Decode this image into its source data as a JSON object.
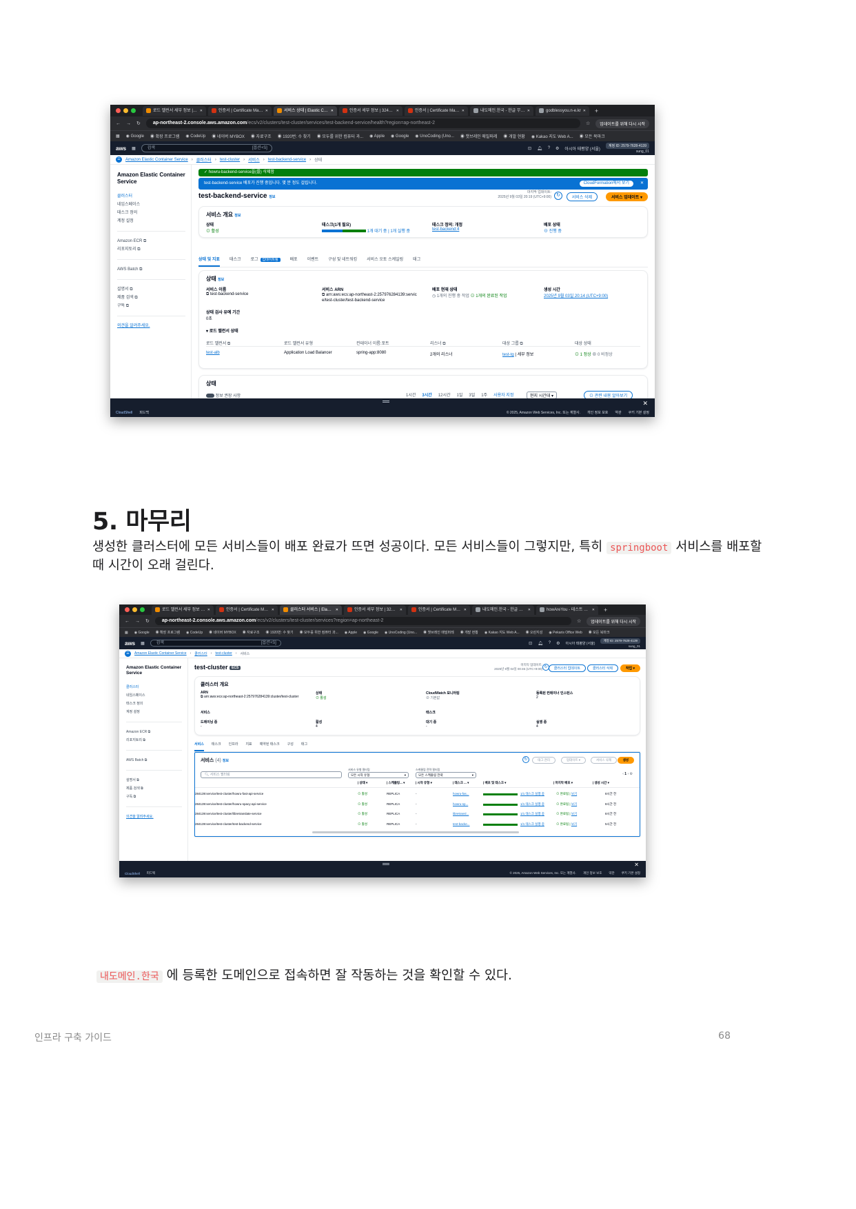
{
  "shot1": {
    "browser_tabs": [
      {
        "label": "로드 밸런서 세부 정보 | EC2",
        "color": "#f08c00"
      },
      {
        "label": "인증서 | Certificate Mana",
        "color": "#d13212"
      },
      {
        "label": "서비스 상태 | Elastic Conta",
        "color": "#f08c00"
      },
      {
        "label": "인증서 세부 정보 | 324448",
        "color": "#d13212"
      },
      {
        "label": "인증서 | Certificate Mana",
        "color": "#d13212"
      },
      {
        "label": "내도메인.한국 - 한글 무료 도",
        "color": "#9aa0a6"
      },
      {
        "label": "godblessyou.n-e.kr",
        "color": "#9aa0a6"
      }
    ],
    "url_host": "ap-northeast-2.console.aws.amazon.com",
    "url_path": "/ecs/v2/clusters/test-cluster/services/test-backend-service/health?region=ap-northeast-2",
    "update_button": "업데이트를 위해 다시 시작",
    "bookmarks": [
      "Google",
      "확장 프로그램",
      "CodeUp",
      "네이버 MYBOX",
      "자료구조",
      "1920번: 수 찾기",
      "모두를 위한 컴퓨터 과...",
      "Apple",
      "Google",
      "UnoCoding (Uno...",
      "챗브레인 매빌퍼레",
      "개발 현황",
      "Kakao 지도 Web A...",
      "모든 북마크"
    ],
    "aws_search_placeholder": "검색",
    "aws_search_kbd": "[옵션+S]",
    "account_id": "계정 ID: 2579-7628-4139",
    "account_user": "sung_01",
    "region": "아시아 태평양 (서울)",
    "breadcrumb": [
      "Amazon Elastic Container Service",
      "클러스터",
      "test-cluster",
      "서비스",
      "test-backend-service",
      "상태"
    ],
    "sidebar_title": "Amazon Elastic Container Service",
    "sidebar_items": [
      "클러스터",
      "네임스페이스",
      "태스크 정의",
      "계정 설정"
    ],
    "sidebar_items2": [
      "Amazon ECR",
      "리포지토리"
    ],
    "sidebar_items3": [
      "AWS Batch"
    ],
    "sidebar_items4": [
      "설명서",
      "제품 검색",
      "구독"
    ],
    "sidebar_feedback": "의견을 알려주세요.",
    "flash_success": "howru-backend-service을(를) 삭제함",
    "flash_info": "test-backend-service 배포가 진행 중입니다. 몇 분 정도 걸립니다.",
    "flash_info_button": "CloudFormation에서 보기",
    "page_title": "test-backend-service",
    "info_label": "정보",
    "last_updated_label": "마지막 업데이트:",
    "last_updated": "2025년 9월 03일 20:19 (UTC+9:00)",
    "delete_service": "서비스 삭제",
    "update_service": "서비스 업데이트",
    "overview_title": "서비스 개요",
    "overview": {
      "status_label": "상태",
      "status_value": "활성",
      "tasks_label": "태스크(1개 필요)",
      "tasks_value": "1개 대기 중 | 1개 실행 중",
      "taskdef_label": "태스크 정의: 개정",
      "taskdef_value": "test-backend:4",
      "deploy_label": "배포 상태",
      "deploy_value": "진행 중"
    },
    "tabs": [
      "상태 및 지표",
      "태스크",
      "로그",
      "배포",
      "이벤트",
      "구성 및 네트워킹",
      "서비스 오토 스케일링",
      "태그"
    ],
    "tab_badge": "업데이트됨",
    "status_title": "상태",
    "status": {
      "name_label": "서비스 이름",
      "name_value": "test-backend-service",
      "arn_label": "서비스 ARN",
      "arn_value": "arn:aws:ecs:ap-northeast-2:257976284139:service/test-cluster/test-backend-service",
      "deploy_label": "배포 현재 상태",
      "deploy_pending": "1개의 진행 중 작업",
      "deploy_done": "1개의 완료된 작업",
      "created_label": "생성 시간",
      "created_value": "2025년 9월 03일 20:14 (UTC+9:00)",
      "grace_label": "상태 검사 유예 기간",
      "grace_value": "0초"
    },
    "lb_title": "로드 밸런서 상태",
    "lb_headers": [
      "로드 밸런서",
      "로드 밸런서 유형",
      "컨테이너 이름:포트",
      "리스너",
      "대상 그룹",
      "대상 상태"
    ],
    "lb_row": [
      "test-alb",
      "Application Load Balancer",
      "spring-app:8080",
      "2개의 리스너",
      "test-tg",
      "세부 정보",
      "1 정상",
      "0 비정상"
    ],
    "health_title": "상태",
    "health_toggle": "정보 권장 사항",
    "time_ranges": [
      "1시간",
      "3시간",
      "12시간",
      "1일",
      "3일",
      "1주",
      "사용자 지정"
    ],
    "timezone": "현지 시간대",
    "related_button": "관련 내용 알아보기",
    "footer_left": [
      "CloudShell",
      "피드백"
    ],
    "footer_right": [
      "© 2025, Amazon Web Services, Inc. 또는 계열사.",
      "개인 정보 보호",
      "약관",
      "쿠키 기본 설정"
    ]
  },
  "heading": "5. 마무리",
  "paragraph_before": "생성한 클러스터에 모든 서비스들이 배포 완료가 뜨면 성공이다. 모든 서비스들이 그렇지만, 특히 ",
  "paragraph_code": "springboot",
  "paragraph_after": " 서비스를 배포할때 시간이 오래 걸린다.",
  "shot2": {
    "browser_tabs": [
      {
        "label": "로드 밸런서 세부 정보 | EC2 | ap",
        "color": "#f08c00"
      },
      {
        "label": "인증서 | Certificate Manager",
        "color": "#d13212"
      },
      {
        "label": "클러스터 서비스 | Elastic Contai",
        "color": "#f08c00"
      },
      {
        "label": "인증서 세부 정보 | 324448d3-",
        "color": "#d13212"
      },
      {
        "label": "인증서 | Certificate Manager",
        "color": "#d13212"
      },
      {
        "label": "내도메인.한국 - 한글 무료 도메인",
        "color": "#9aa0a6"
      },
      {
        "label": "howAreYou - 테스트 페이지",
        "color": "#9aa0a6"
      }
    ],
    "url_host": "ap-northeast-2.console.aws.amazon.com",
    "url_path": "/ecs/v2/clusters/test-cluster/services?region=ap-northeast-2",
    "update_button": "업데이트를 위해 다시 시작",
    "bookmarks": [
      "Google",
      "확장 프로그램",
      "CodeUp",
      "네이버 MYBOX",
      "자료구조",
      "1920번: 수 찾기",
      "모두를 위한 컴퓨터 과...",
      "Apple",
      "Google",
      "UnoCoding (Uno...",
      "챗브레인 매빌퍼레",
      "개발 현황",
      "Kakao 지도 Web A...",
      "오린지성",
      "Pekaris Office Web",
      "모든 북마크"
    ],
    "breadcrumb": [
      "Amazon Elastic Container Service",
      "클러스터",
      "test-cluster",
      "서비스"
    ],
    "page_title": "test-cluster",
    "title_badge": "ECS",
    "last_updated": "2025년 9월 04일 00:46 (UTC+9:00)",
    "buttons": [
      "클러스터 업데이트",
      "클러스터 삭제",
      "작업"
    ],
    "overview_title": "클러스터 개요",
    "overview": {
      "arn_label": "ARN",
      "arn_value": "arn:aws:ecs:ap-northeast-2:257976284139:cluster/test-cluster",
      "status_label": "상태",
      "status_value": "활성",
      "cw_label": "CloudWatch 모니터링",
      "cw_value": "기본값",
      "ci_label": "등록된 컨테이너 인스턴스",
      "ci_value": "2",
      "services_label": "서비스",
      "draining_label": "드레이닝 중",
      "draining_value": "-",
      "active_label": "활성",
      "active_value": "4",
      "tasks_label": "태스크",
      "pending_label": "대기 중",
      "pending_value": "-",
      "running_label": "실행 중",
      "running_value": "4"
    },
    "tabs": [
      "서비스",
      "태스크",
      "인프라",
      "지표",
      "예약된 태스크",
      "구성",
      "태그"
    ],
    "services_title": "서비스",
    "services_count": "(4)",
    "service_buttons": [
      "태그 관리",
      "업데이트",
      "서비스 삭제",
      "생성"
    ],
    "search_placeholder": "서비스 필터링",
    "filter1_label": "서비스 유형 필터링",
    "filter1_value": "모든 시작 유형",
    "filter2_label": "스케줄링 전략 필터링",
    "filter2_value": "모든 스케줄링 전략",
    "pagination": "1",
    "columns": [
      "ARN",
      "상태",
      "스케줄링...",
      "시작 유형",
      "태스크 ...",
      "배포 및 태스크",
      "마지막 배포",
      "생성 시간"
    ],
    "rows": [
      {
        "arn": "284139:service/test-cluster/howru-fast-api-service",
        "status": "활성",
        "sched": "REPLICA",
        "launch": "-",
        "taskdef": "howru-fas...",
        "tasks": "1/1 태스크 실행 중",
        "deploy": "완료됨",
        "deploy_link": "보기",
        "created": "8시간 전"
      },
      {
        "arn": "284139:service/test-cluster/howru-spacy-api-service",
        "status": "활성",
        "sched": "REPLICA",
        "launch": "-",
        "taskdef": "howru-sp...",
        "tasks": "1/1 태스크 실행 중",
        "deploy": "완료됨",
        "deploy_link": "보기",
        "created": "8시간 전"
      },
      {
        "arn": "284139:service/test-cluster/libretranslate-service",
        "status": "활성",
        "sched": "REPLICA",
        "launch": "-",
        "taskdef": "libretransl...",
        "tasks": "1/1 태스크 실행 중",
        "deploy": "완료됨",
        "deploy_link": "보기",
        "created": "8시간 전"
      },
      {
        "arn": "284139:service/test-cluster/test-backend-service",
        "status": "활성",
        "sched": "REPLICA",
        "launch": "-",
        "taskdef": "test-backe...",
        "tasks": "1/1 태스크 실행 중",
        "deploy": "완료됨",
        "deploy_link": "보기",
        "created": "5시간 전"
      }
    ]
  },
  "paragraph2_code": "내도메인.한국",
  "paragraph2_text": " 에 등록한 도메인으로 접속하면 잘 작동하는 것을 확인할 수 있다.",
  "footer_title": "인프라 구축 가이드",
  "page_number": "68",
  "colors": {
    "aws_blue": "#0972d3",
    "aws_orange": "#ff9900",
    "aws_nav": "#161e2d",
    "success": "#037f0c",
    "code_red": "#eb5757"
  }
}
